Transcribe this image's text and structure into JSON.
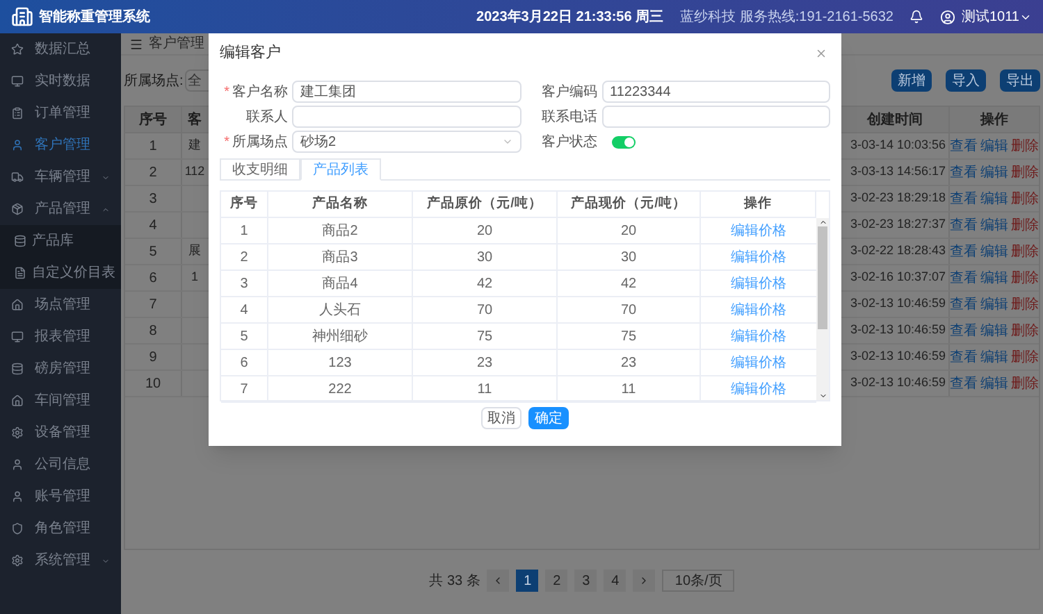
{
  "header": {
    "title": "智能称重管理系统",
    "datetime": "2023年3月22日 21:33:56 周三",
    "hotline": "蓝纱科技 服务热线:191-2161-5632",
    "user": "测试1011"
  },
  "sidebar": {
    "items": [
      {
        "label": "数据汇总",
        "kind": "link",
        "selected": false
      },
      {
        "label": "实时数据",
        "kind": "link",
        "selected": false
      },
      {
        "label": "订单管理",
        "kind": "link",
        "selected": false
      },
      {
        "label": "客户管理",
        "kind": "link",
        "selected": true
      },
      {
        "label": "车辆管理",
        "kind": "group",
        "selected": false,
        "expanded": false
      },
      {
        "label": "产品管理",
        "kind": "group",
        "selected": false,
        "expanded": true,
        "children": [
          {
            "label": "产品库",
            "selected": false
          },
          {
            "label": "自定义价目表",
            "selected": false
          }
        ]
      },
      {
        "label": "场点管理",
        "kind": "link",
        "selected": false
      },
      {
        "label": "报表管理",
        "kind": "link",
        "selected": false
      },
      {
        "label": "磅房管理",
        "kind": "link",
        "selected": false
      },
      {
        "label": "车间管理",
        "kind": "link",
        "selected": false
      },
      {
        "label": "设备管理",
        "kind": "link",
        "selected": false
      },
      {
        "label": "公司信息",
        "kind": "link",
        "selected": false
      },
      {
        "label": "账号管理",
        "kind": "link",
        "selected": false
      },
      {
        "label": "角色管理",
        "kind": "link",
        "selected": false
      },
      {
        "label": "系统管理",
        "kind": "group",
        "selected": false,
        "expanded": false
      }
    ]
  },
  "breadcrumb_tab": "客户管理",
  "filter": {
    "label": "所属场点:",
    "value": "全"
  },
  "toolbar": {
    "buttons": [
      "新增",
      "导入",
      "导出"
    ]
  },
  "table": {
    "columns": [
      "序号",
      "客",
      "创建时间",
      "操作"
    ],
    "rows": [
      {
        "index": "1",
        "column_2": "建",
        "created": "3-03-14 10:03:56",
        "actions": [
          {
            "label": "查看",
            "kind": "link"
          },
          {
            "label": "编辑",
            "kind": "link"
          },
          {
            "label": "删除",
            "kind": "danger"
          }
        ]
      },
      {
        "index": "2",
        "column_2": "112",
        "created": "3-03-13 14:56:17",
        "actions": [
          {
            "label": "查看",
            "kind": "link"
          },
          {
            "label": "编辑",
            "kind": "link"
          },
          {
            "label": "删除",
            "kind": "danger"
          }
        ]
      },
      {
        "index": "3",
        "created": "3-02-23 18:29:18",
        "actions": [
          {
            "label": "查看",
            "kind": "link"
          },
          {
            "label": "编辑",
            "kind": "link"
          },
          {
            "label": "删除",
            "kind": "danger"
          }
        ]
      },
      {
        "index": "4",
        "created": "3-02-23 18:27:37",
        "actions": [
          {
            "label": "查看",
            "kind": "link"
          },
          {
            "label": "编辑",
            "kind": "link"
          },
          {
            "label": "删除",
            "kind": "danger"
          }
        ]
      },
      {
        "index": "5",
        "column_2": "展",
        "created": "3-02-22 18:28:43",
        "actions": [
          {
            "label": "查看",
            "kind": "link"
          },
          {
            "label": "编辑",
            "kind": "link"
          },
          {
            "label": "删除",
            "kind": "danger"
          }
        ]
      },
      {
        "index": "6",
        "column_2": "1",
        "created": "3-02-16 10:37:07",
        "actions": [
          {
            "label": "查看",
            "kind": "link"
          },
          {
            "label": "编辑",
            "kind": "link"
          },
          {
            "label": "删除",
            "kind": "danger"
          }
        ]
      },
      {
        "index": "7",
        "created": "3-02-13 10:46:59",
        "actions": [
          {
            "label": "查看",
            "kind": "link"
          },
          {
            "label": "编辑",
            "kind": "link"
          },
          {
            "label": "删除",
            "kind": "danger"
          }
        ]
      },
      {
        "index": "8",
        "created": "3-02-13 10:46:59",
        "actions": [
          {
            "label": "查看",
            "kind": "link"
          },
          {
            "label": "编辑",
            "kind": "link"
          },
          {
            "label": "删除",
            "kind": "danger"
          }
        ]
      },
      {
        "index": "9",
        "created": "3-02-13 10:46:59",
        "actions": [
          {
            "label": "查看",
            "kind": "link"
          },
          {
            "label": "编辑",
            "kind": "link"
          },
          {
            "label": "删除",
            "kind": "danger"
          }
        ]
      },
      {
        "index": "10",
        "created": "3-02-13 10:46:59",
        "actions": [
          {
            "label": "查看",
            "kind": "link"
          },
          {
            "label": "编辑",
            "kind": "link"
          },
          {
            "label": "删除",
            "kind": "danger"
          }
        ]
      }
    ]
  },
  "pagination": {
    "total": "共 33 条",
    "pages": [
      {
        "label": "1",
        "selected": true
      },
      {
        "label": "2",
        "selected": false
      },
      {
        "label": "3",
        "selected": false
      },
      {
        "label": "4",
        "selected": false
      }
    ],
    "page_size": "10条/页"
  },
  "dialog": {
    "title": "编辑客户",
    "fields": [
      {
        "label": "客户名称",
        "required_mark": "*",
        "kind": "input",
        "value": "建工集团"
      },
      {
        "label": "客户编码",
        "kind": "input",
        "value": "11223344"
      },
      {
        "label": "联系人",
        "kind": "input"
      },
      {
        "label": "联系电话",
        "kind": "input"
      },
      {
        "label": "所属场点",
        "required_mark": "*",
        "kind": "select",
        "value": "砂场2"
      },
      {
        "label": "客户状态",
        "kind": "switch",
        "on": true
      }
    ],
    "tabs": [
      {
        "label": "收支明细",
        "selected": false
      },
      {
        "label": "产品列表",
        "selected": true
      }
    ],
    "table": {
      "columns": [
        "序号",
        "产品名称",
        "产品原价（元/吨）",
        "产品现价（元/吨）",
        "操作"
      ],
      "rows": [
        {
          "cells": [
            "1",
            "商品2",
            "20",
            "20"
          ],
          "action": "编辑价格"
        },
        {
          "cells": [
            "2",
            "商品3",
            "30",
            "30"
          ],
          "action": "编辑价格"
        },
        {
          "cells": [
            "3",
            "商品4",
            "42",
            "42"
          ],
          "action": "编辑价格"
        },
        {
          "cells": [
            "4",
            "人头石",
            "70",
            "70"
          ],
          "action": "编辑价格"
        },
        {
          "cells": [
            "5",
            "神州细砂",
            "75",
            "75"
          ],
          "action": "编辑价格"
        },
        {
          "cells": [
            "6",
            "123",
            "23",
            "23"
          ],
          "action": "编辑价格"
        },
        {
          "cells": [
            "7",
            "222",
            "11",
            "11"
          ],
          "action": "编辑价格"
        }
      ]
    },
    "buttons": [
      {
        "label": "取消",
        "kind": "default"
      },
      {
        "label": "确定",
        "kind": "primary"
      }
    ]
  }
}
